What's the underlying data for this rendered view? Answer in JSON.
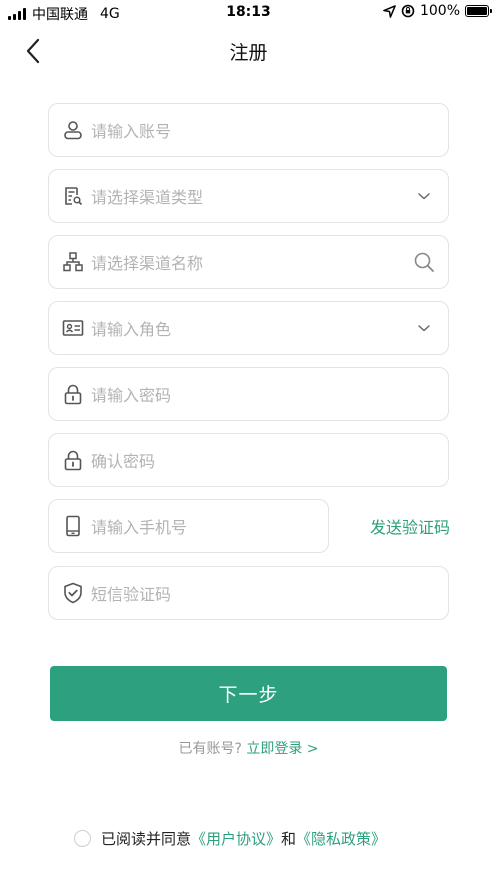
{
  "status_bar": {
    "carrier": "中国联通",
    "network": "4G",
    "time": "18:13",
    "battery": "100%",
    "battery_level": 1.0
  },
  "nav": {
    "title": "注册",
    "back_icon": "chevron-left-icon"
  },
  "fields": {
    "account": {
      "placeholder": "请输入账号",
      "icon": "user-icon"
    },
    "channel_type": {
      "placeholder": "请选择渠道类型",
      "icon": "document-search-icon",
      "trailing_icon": "chevron-down-icon"
    },
    "channel_name": {
      "placeholder": "请选择渠道名称",
      "icon": "org-chart-icon",
      "trailing_icon": "search-icon"
    },
    "role": {
      "placeholder": "请输入角色",
      "icon": "id-card-icon",
      "trailing_icon": "chevron-down-icon"
    },
    "password": {
      "placeholder": "请输入密码",
      "icon": "lock-icon"
    },
    "confirm_password": {
      "placeholder": "确认密码",
      "icon": "lock-icon"
    },
    "phone": {
      "placeholder": "请输入手机号",
      "icon": "phone-icon"
    },
    "sms_code": {
      "placeholder": "短信验证码",
      "icon": "shield-check-icon"
    }
  },
  "send_code_label": "发送验证码",
  "next_button_label": "下一步",
  "login_prompt": {
    "text": "已有账号?",
    "link": "立即登录 >"
  },
  "agreement": {
    "prefix": "已阅读并同意",
    "user_agreement": "《用户协议》",
    "and": "和",
    "privacy_policy": "《隐私政策》",
    "checked": false
  },
  "colors": {
    "accent": "#2ca07f",
    "link": "#2e9f7e",
    "placeholder": "#b3b3b3",
    "border": "#e3e3e3"
  }
}
